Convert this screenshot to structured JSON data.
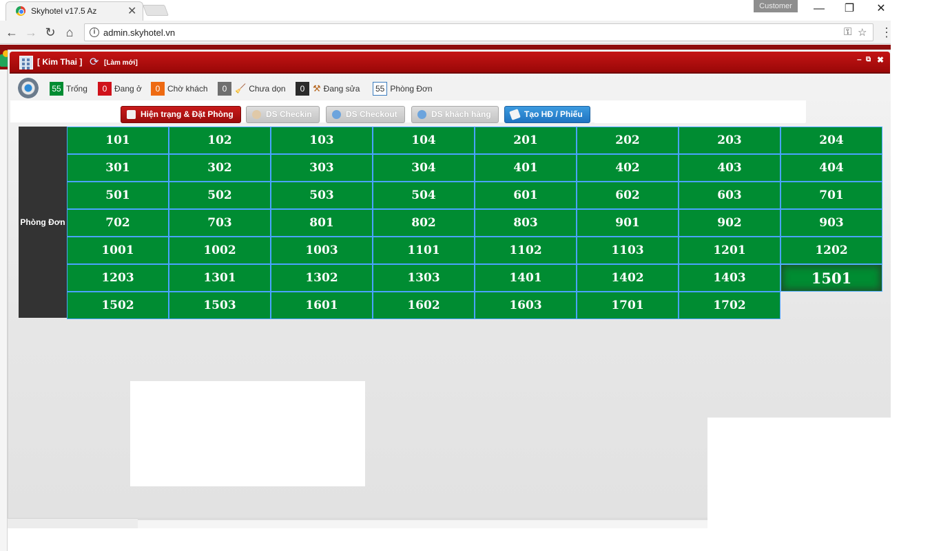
{
  "browser": {
    "tab_title": "Skyhotel v17.5 Az",
    "tab_close": "✕",
    "profile": "Customer",
    "url": "admin.skyhotel.vn",
    "info": "i",
    "back": "←",
    "forward": "→",
    "reload": "↻",
    "home": "⌂",
    "key": "⚿",
    "star": "☆",
    "menu": "⋮",
    "minimize": "—",
    "maximize": "❐",
    "close": "✕"
  },
  "header": {
    "hotel_name": "[ Kim Thai ]",
    "refresh_label": "[Làm mới]",
    "refresh_glyph": "⟳",
    "min_glyph": "–",
    "restore_glyph": "⧉",
    "close_glyph": "✖"
  },
  "status": [
    {
      "count": "55",
      "label": "Trống",
      "color": "#008c32",
      "icon": ""
    },
    {
      "count": "0",
      "label": "Đang ở",
      "color": "#d0121b",
      "icon": ""
    },
    {
      "count": "0",
      "label": "Chờ khách",
      "color": "#ee6a12",
      "icon": ""
    },
    {
      "count": "0",
      "label": "Chưa dọn",
      "color": "#6f6f6f",
      "icon": "🧹"
    },
    {
      "count": "0",
      "label": "Đang sửa",
      "color": "#2b2b2b",
      "icon": "⚒"
    },
    {
      "count": "55",
      "label": "Phòng Đơn",
      "color": "#ffffff",
      "icon": ""
    }
  ],
  "actions": {
    "status_booking": "Hiện trạng & Đặt Phòng",
    "checkin_list": "DS Checkin",
    "checkout_list": "DS Checkout",
    "guest_list": "DS khách hàng",
    "create_invoice": "Tạo HĐ / Phiếu"
  },
  "room_section": {
    "label": "Phòng Đơn",
    "rooms": [
      "101",
      "102",
      "103",
      "104",
      "201",
      "202",
      "203",
      "204",
      "301",
      "302",
      "303",
      "304",
      "401",
      "402",
      "403",
      "404",
      "501",
      "502",
      "503",
      "504",
      "601",
      "602",
      "603",
      "701",
      "702",
      "703",
      "801",
      "802",
      "803",
      "901",
      "902",
      "903",
      "1001",
      "1002",
      "1003",
      "1101",
      "1102",
      "1103",
      "1201",
      "1202",
      "1203",
      "1301",
      "1302",
      "1303",
      "1401",
      "1402",
      "1403",
      "1501",
      "1502",
      "1503",
      "1601",
      "1602",
      "1603",
      "1701",
      "1702"
    ],
    "selected": "1501",
    "room_color": "#008c32"
  }
}
